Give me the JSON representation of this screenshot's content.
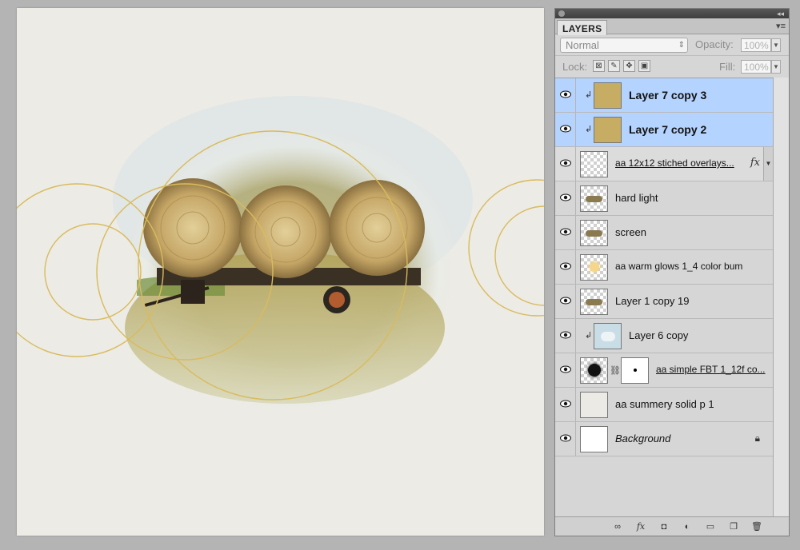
{
  "panel": {
    "tab_label": "LAYERS",
    "blend_mode": "Normal",
    "opacity_label": "Opacity:",
    "opacity_value": "100%",
    "lock_label": "Lock:",
    "fill_label": "Fill:",
    "fill_value": "100%"
  },
  "layers": [
    {
      "name": "Layer 7 copy 3",
      "selected": true,
      "clipped": true,
      "thumb": "tan"
    },
    {
      "name": "Layer 7 copy 2",
      "selected": true,
      "clipped": true,
      "thumb": "tan"
    },
    {
      "name": "aa 12x12 stiched overlays...",
      "selected": false,
      "clipped": false,
      "thumb": "checker",
      "fx": "fx"
    },
    {
      "name": "hard light",
      "selected": false,
      "clipped": false,
      "thumb": "hay"
    },
    {
      "name": "screen",
      "selected": false,
      "clipped": false,
      "thumb": "hay"
    },
    {
      "name": "aa warm glows 1_4 color bum",
      "selected": false,
      "clipped": false,
      "thumb": "glow"
    },
    {
      "name": "Layer 1 copy 19",
      "selected": false,
      "clipped": false,
      "thumb": "hay"
    },
    {
      "name": "Layer 6 copy",
      "selected": false,
      "clipped": true,
      "thumb": "blue"
    },
    {
      "name": "aa simple FBT 1_12f co...",
      "selected": false,
      "clipped": false,
      "thumb": "mask"
    },
    {
      "name": "aa summery solid p 1",
      "selected": false,
      "clipped": false,
      "thumb": "paper"
    },
    {
      "name": "Background",
      "selected": false,
      "clipped": false,
      "thumb": "white",
      "locked": true
    }
  ],
  "colors": {
    "selected_row": "#b4d3fe",
    "canvas_paper": "#ecebe6",
    "gold_thread": "#d9bb5c",
    "hay": "#c8a862"
  },
  "icons": [
    "link-icon",
    "fx-icon",
    "mask-icon",
    "adjustment-icon",
    "folder-icon",
    "new-layer-icon",
    "trash-icon"
  ]
}
